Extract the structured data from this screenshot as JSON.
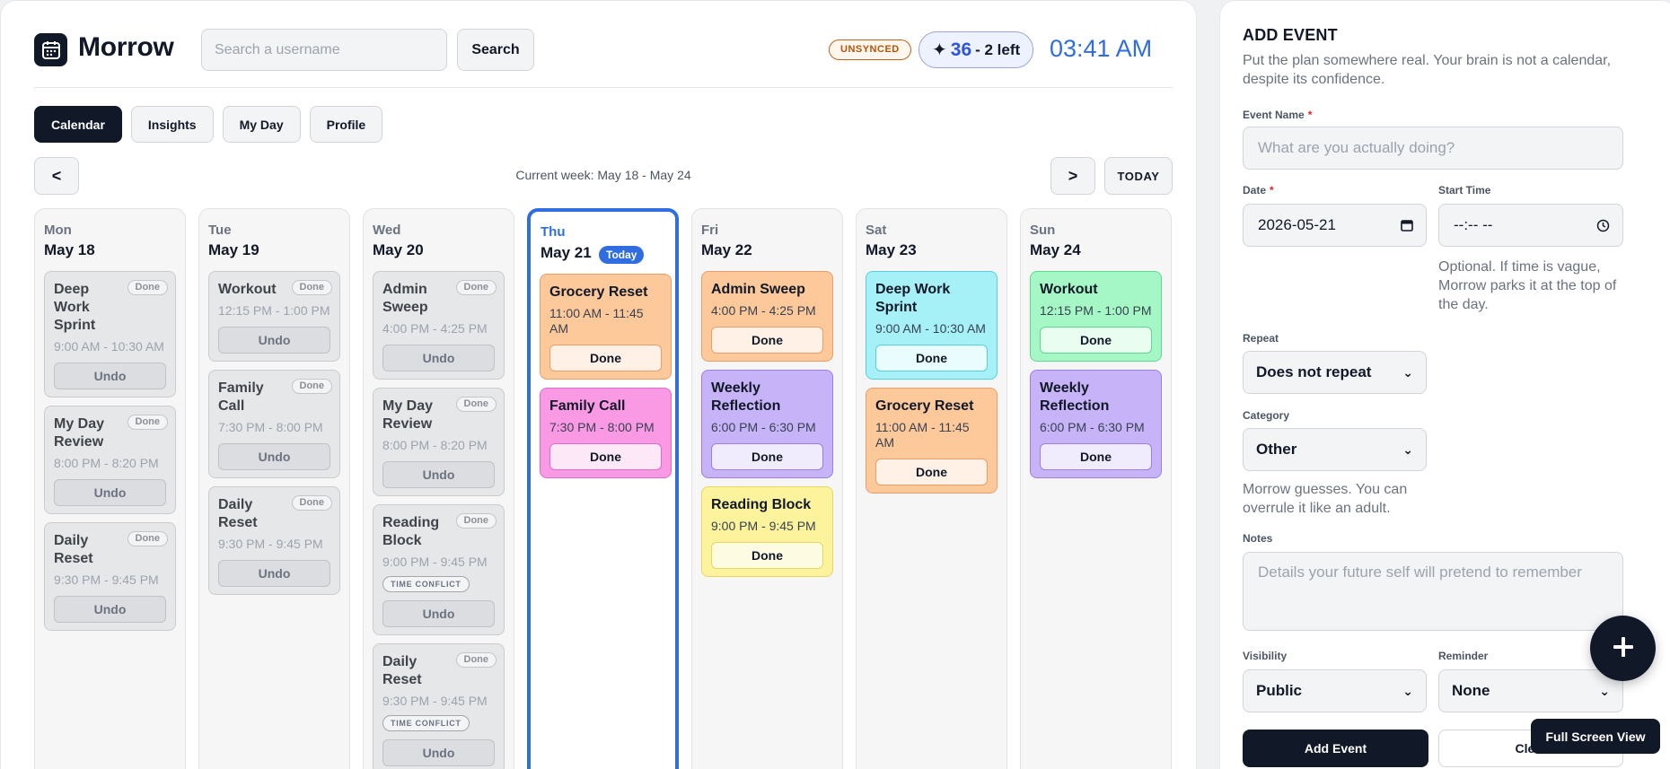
{
  "app": {
    "title": "Morrow",
    "search_placeholder": "Search a username",
    "search_label": "Search",
    "sync_status": "UNSYNCED",
    "streak_icon": "sparkle-icon",
    "streak_count": "36",
    "streak_left": "- 2 left",
    "clock": "03:41 AM"
  },
  "tabs": [
    "Calendar",
    "Insights",
    "My Day",
    "Profile"
  ],
  "week": {
    "prev": "<",
    "next": ">",
    "today": "TODAY",
    "label": "Current week: May 18 - May 24"
  },
  "labels": {
    "done": "Done",
    "undo": "Undo",
    "done_tag": "Done",
    "today_pill": "Today",
    "conflict": "TIME CONFLICT"
  },
  "days": [
    {
      "name": "Mon",
      "date": "May 18",
      "today": false,
      "events": [
        {
          "title": "Deep Work Sprint",
          "time": "9:00 AM - 10:30 AM",
          "color": "done",
          "done": true
        },
        {
          "title": "My Day Review",
          "time": "8:00 PM - 8:20 PM",
          "color": "done",
          "done": true
        },
        {
          "title": "Daily Reset",
          "time": "9:30 PM - 9:45 PM",
          "color": "done",
          "done": true
        }
      ]
    },
    {
      "name": "Tue",
      "date": "May 19",
      "today": false,
      "events": [
        {
          "title": "Workout",
          "time": "12:15 PM - 1:00 PM",
          "color": "done",
          "done": true
        },
        {
          "title": "Family Call",
          "time": "7:30 PM - 8:00 PM",
          "color": "done",
          "done": true
        },
        {
          "title": "Daily Reset",
          "time": "9:30 PM - 9:45 PM",
          "color": "done",
          "done": true
        }
      ]
    },
    {
      "name": "Wed",
      "date": "May 20",
      "today": false,
      "events": [
        {
          "title": "Admin Sweep",
          "time": "4:00 PM - 4:25 PM",
          "color": "done",
          "done": true
        },
        {
          "title": "My Day Review",
          "time": "8:00 PM - 8:20 PM",
          "color": "done",
          "done": true
        },
        {
          "title": "Reading Block",
          "time": "9:00 PM - 9:45 PM",
          "color": "done",
          "done": true,
          "conflict": true
        },
        {
          "title": "Daily Reset",
          "time": "9:30 PM - 9:45 PM",
          "color": "done",
          "done": true,
          "conflict": true
        }
      ]
    },
    {
      "name": "Thu",
      "date": "May 21",
      "today": true,
      "events": [
        {
          "title": "Grocery Reset",
          "time": "11:00 AM - 11:45 AM",
          "color": "orange",
          "done": false
        },
        {
          "title": "Family Call",
          "time": "7:30 PM - 8:00 PM",
          "color": "pink",
          "done": false
        }
      ]
    },
    {
      "name": "Fri",
      "date": "May 22",
      "today": false,
      "events": [
        {
          "title": "Admin Sweep",
          "time": "4:00 PM - 4:25 PM",
          "color": "orange",
          "done": false
        },
        {
          "title": "Weekly Reflection",
          "time": "6:00 PM - 6:30 PM",
          "color": "purple",
          "done": false
        },
        {
          "title": "Reading Block",
          "time": "9:00 PM - 9:45 PM",
          "color": "yellow",
          "done": false
        }
      ]
    },
    {
      "name": "Sat",
      "date": "May 23",
      "today": false,
      "events": [
        {
          "title": "Deep Work Sprint",
          "time": "9:00 AM - 10:30 AM",
          "color": "cyan",
          "done": false
        },
        {
          "title": "Grocery Reset",
          "time": "11:00 AM - 11:45 AM",
          "color": "orange",
          "done": false
        }
      ]
    },
    {
      "name": "Sun",
      "date": "May 24",
      "today": false,
      "events": [
        {
          "title": "Workout",
          "time": "12:15 PM - 1:00 PM",
          "color": "green",
          "done": false
        },
        {
          "title": "Weekly Reflection",
          "time": "6:00 PM - 6:30 PM",
          "color": "purple",
          "done": false
        }
      ]
    }
  ],
  "form": {
    "title": "ADD EVENT",
    "subtitle": "Put the plan somewhere real. Your brain is not a calendar, despite its confidence.",
    "event_name_label": "Event Name",
    "event_name_placeholder": "What are you actually doing?",
    "required_mark": "*",
    "date_label": "Date",
    "date_value": "2026-05-21",
    "start_time_label": "Start Time",
    "start_time_hint": "Optional. If time is vague, Morrow parks it at the top of the day.",
    "repeat_label": "Repeat",
    "repeat_value": "Does not repeat",
    "category_label": "Category",
    "category_value": "Other",
    "category_hint": "Morrow guesses. You can overrule it like an adult.",
    "notes_label": "Notes",
    "notes_placeholder": "Details your future self will pretend to remember",
    "visibility_label": "Visibility",
    "visibility_value": "Public",
    "reminder_label": "Reminder",
    "reminder_value": "None",
    "add_label": "Add Event",
    "clear_label": "Clear"
  },
  "fab": {
    "icon": "plus-icon"
  },
  "fullscreen_label": "Full Screen View",
  "colors": {
    "accent_blue": "#2f6de0",
    "dark": "#111827",
    "orange": "#fdc99b",
    "pink": "#fb9ae4",
    "purple": "#c7b3f7",
    "yellow": "#fcf39c",
    "cyan": "#a6f0f8",
    "green": "#a6f7c6",
    "done_gray": "#e6e7e9"
  }
}
